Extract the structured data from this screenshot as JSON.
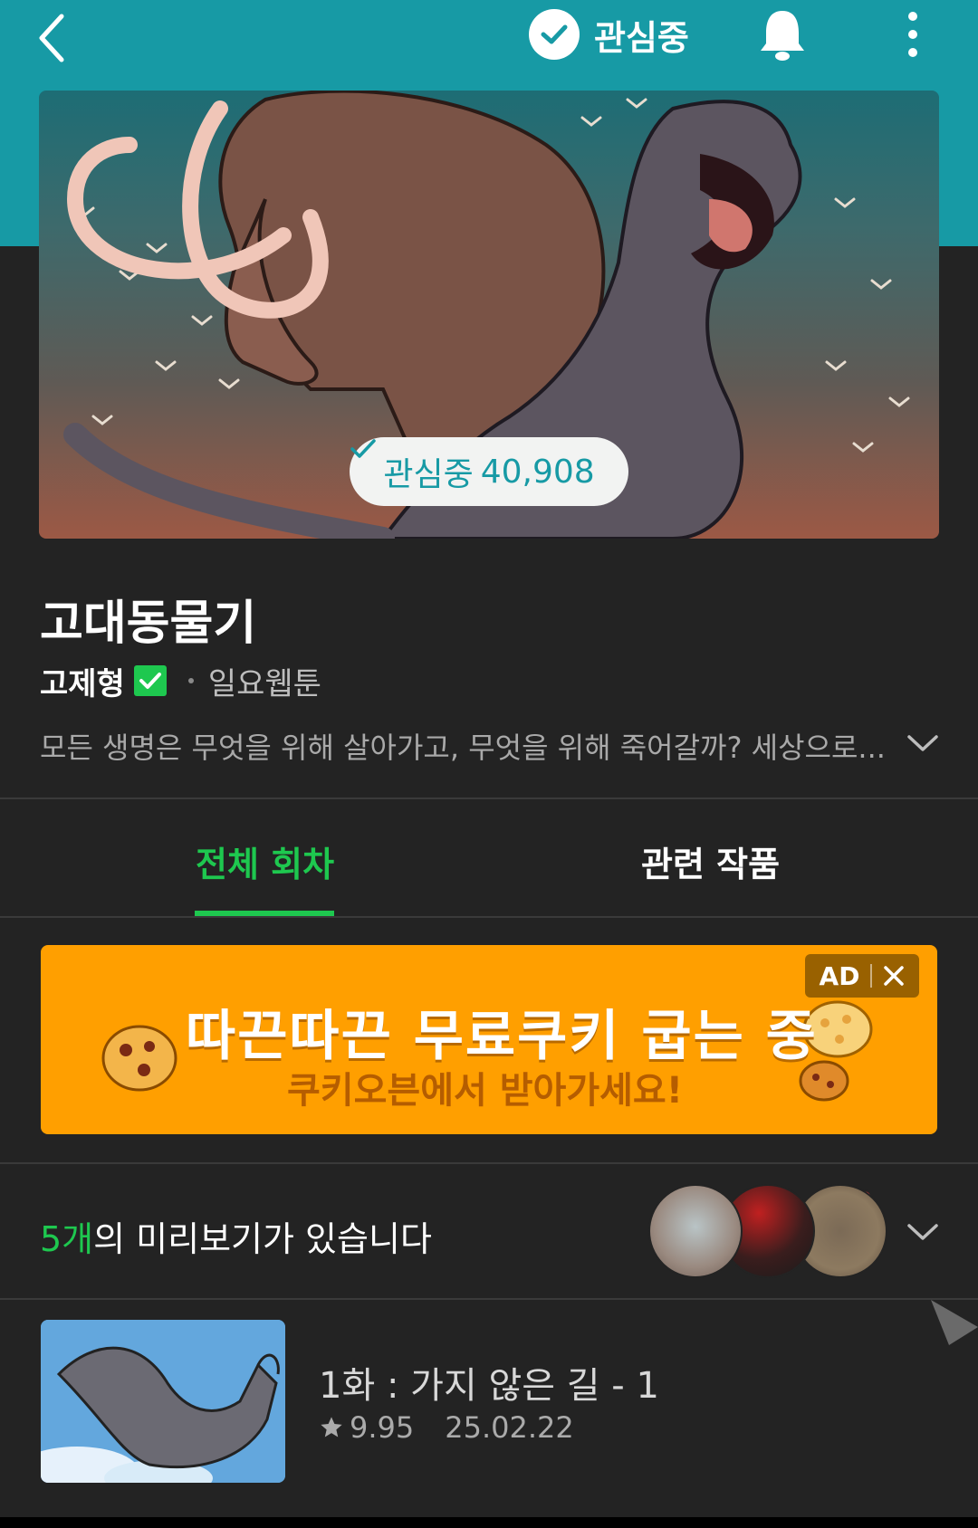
{
  "header": {
    "follow_label": "관심중",
    "back_icon": "chevron-left-icon",
    "bell_icon": "bell-icon",
    "more_icon": "more-vertical-icon"
  },
  "hero": {
    "badge_label": "관심중",
    "badge_count": "40,908"
  },
  "title": {
    "name": "고대동물기",
    "author": "고제형",
    "day": "일요웹툰",
    "description": "모든 생명은 무엇을 위해 살아가고, 무엇을 위해 죽어갈까? 세상으로..."
  },
  "tabs": [
    {
      "label": "전체 회차",
      "active": true
    },
    {
      "label": "관련 작품",
      "active": false
    }
  ],
  "ad": {
    "headline": "따끈따끈 무료쿠키 굽는 중",
    "subline": "쿠키오븐에서 받아가세요!",
    "tag": "AD"
  },
  "preview": {
    "count": "5개",
    "text": "의 미리보기가 있습니다"
  },
  "episodes": [
    {
      "title": "1화 : 가지 않은 길 - 1",
      "rating": "9.95",
      "date": "25.02.22"
    }
  ],
  "colors": {
    "accent_green": "#1ec84f",
    "teal": "#179aa5",
    "ad_orange": "#ff9f00",
    "background": "#232323"
  }
}
